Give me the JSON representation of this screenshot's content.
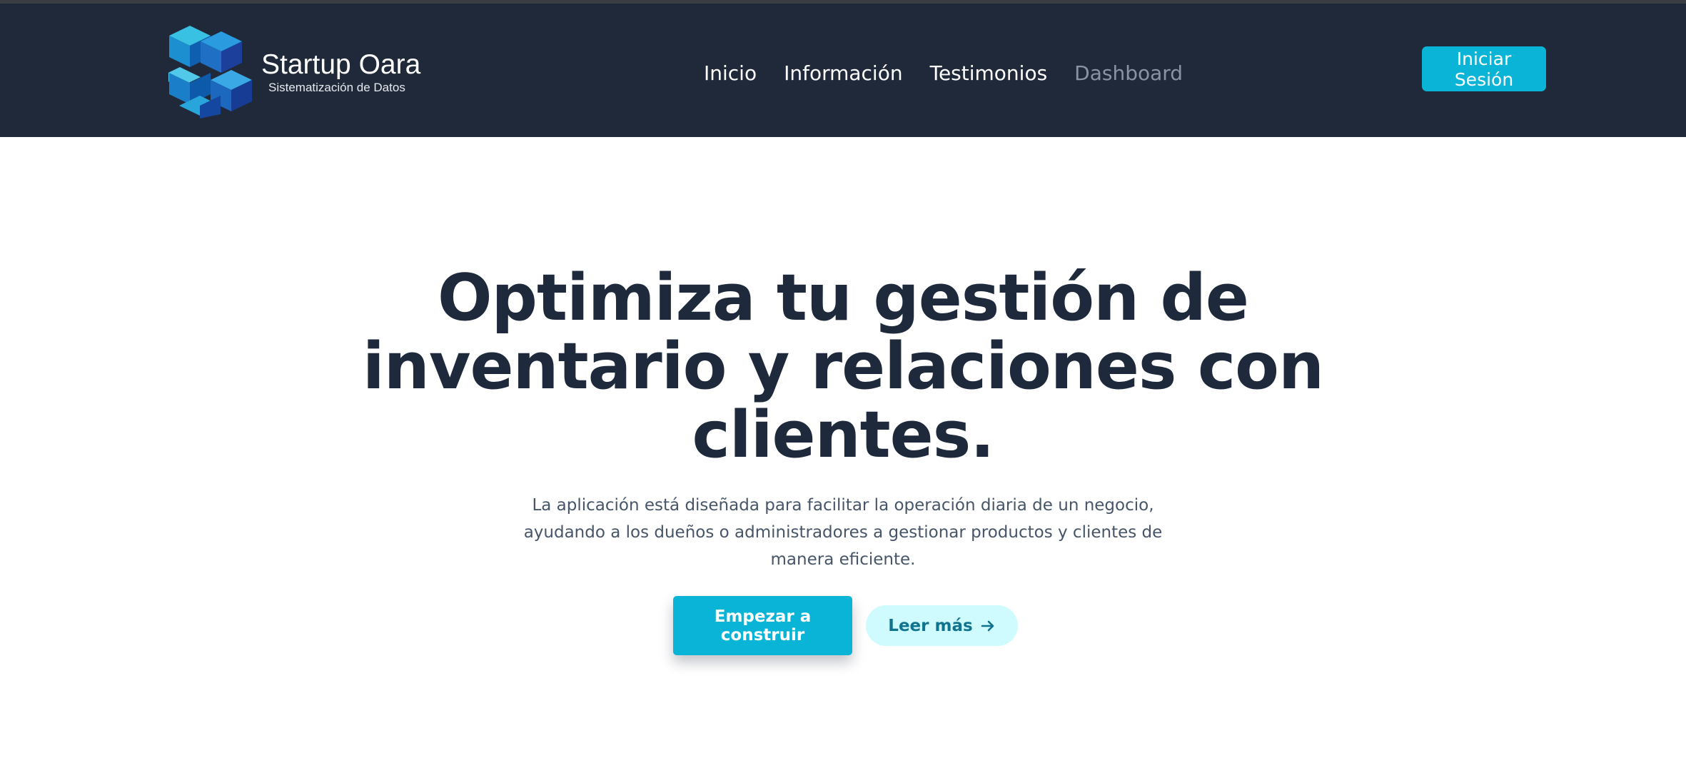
{
  "brand": {
    "name": "Startup Oara",
    "tagline": "Sistematización de Datos"
  },
  "nav": {
    "items": [
      {
        "label": "Inicio"
      },
      {
        "label": "Información"
      },
      {
        "label": "Testimonios"
      },
      {
        "label": "Dashboard"
      }
    ],
    "login_label": "Iniciar Sesión"
  },
  "hero": {
    "title": "Optimiza tu gestión de inventario y relaciones con clientes.",
    "description": "La aplicación está diseñada para facilitar la operación diaria de un negocio, ayudando a los dueños o administradores a gestionar productos y clientes de manera eficiente.",
    "primary_cta": "Empezar a construir",
    "secondary_cta": "Leer más",
    "secondary_icon": "arrow-right-icon"
  },
  "colors": {
    "navbar_bg": "#202939",
    "accent": "#0ab4d6",
    "title_text": "#1e293b",
    "secondary_bg": "#cffafe",
    "secondary_text": "#0e7490"
  }
}
